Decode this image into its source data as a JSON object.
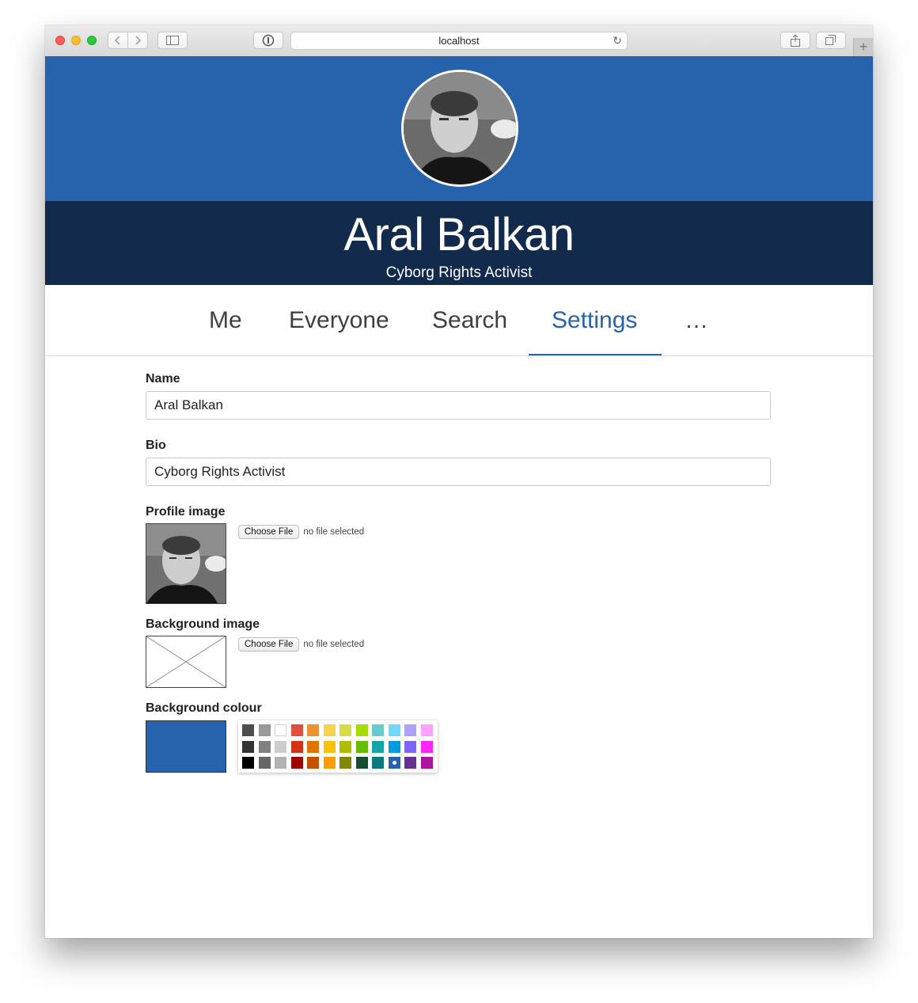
{
  "browser": {
    "url": "localhost",
    "reload_icon": "reload-icon",
    "back_icon": "chevron-left-icon",
    "forward_icon": "chevron-right-icon"
  },
  "profile": {
    "name": "Aral Balkan",
    "bio": "Cyborg Rights Activist"
  },
  "nav": {
    "tabs": [
      {
        "label": "Me"
      },
      {
        "label": "Everyone"
      },
      {
        "label": "Search"
      },
      {
        "label": "Settings",
        "active": true
      },
      {
        "label": "…"
      }
    ]
  },
  "form": {
    "name_label": "Name",
    "name_value": "Aral Balkan",
    "bio_label": "Bio",
    "bio_value": "Cyborg Rights Activist",
    "profile_image_label": "Profile image",
    "background_image_label": "Background image",
    "background_colour_label": "Background colour",
    "choose_file_label": "Choose File",
    "no_file_text": "no file selected",
    "selected_colour": "#2762ad"
  },
  "palette": {
    "rows": [
      [
        "#4d4d4d",
        "#999999",
        "#ffffff",
        "#e0503f",
        "#ed9136",
        "#f6d34a",
        "#d6de47",
        "#a4dd00",
        "#68ccca",
        "#73d8ff",
        "#aea1ff",
        "#fda1ff"
      ],
      [
        "#333333",
        "#808080",
        "#cccccc",
        "#d33115",
        "#e27300",
        "#fcc400",
        "#b0bc00",
        "#68bc00",
        "#16a5a5",
        "#009ce0",
        "#7b64ff",
        "#fa28ff"
      ],
      [
        "#000000",
        "#666666",
        "#b3b3b3",
        "#9f0500",
        "#c45100",
        "#fb9e00",
        "#808900",
        "#194d33",
        "#0c797d",
        "#2762ad",
        "#653294",
        "#ab149e"
      ]
    ],
    "selected": [
      2,
      9
    ]
  }
}
